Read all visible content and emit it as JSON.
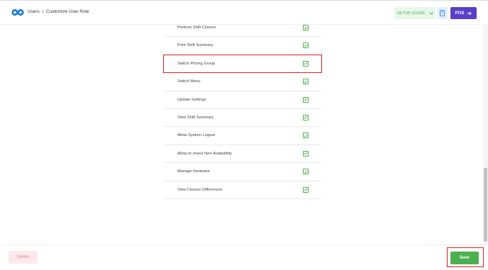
{
  "header": {
    "breadcrumb_parent": "Users",
    "breadcrumb_separator": "/",
    "breadcrumb_current": "Customize User Role",
    "setup_guide_label": "SETUP GUIDE",
    "pos_label": "POS"
  },
  "permissions": [
    {
      "label": "Perform Shift Closure",
      "checked": true
    },
    {
      "label": "Print Shift Summary",
      "checked": true
    },
    {
      "label": "Switch Pricing Group",
      "checked": true
    },
    {
      "label": "Switch Menu",
      "checked": true
    },
    {
      "label": "Update Settings",
      "checked": true
    },
    {
      "label": "View Shift Summary",
      "checked": true
    },
    {
      "label": "Allow System Logout",
      "checked": true
    },
    {
      "label": "Allow to check Item Availability",
      "checked": true
    },
    {
      "label": "Manage hardware",
      "checked": true
    },
    {
      "label": "View Closure Differences",
      "checked": true
    }
  ],
  "footer": {
    "delete_label": "Delete",
    "save_label": "Save"
  },
  "colors": {
    "accent_green": "#4caf50",
    "pos_purple": "#5b3fc7",
    "highlight_red": "#e01e1e"
  },
  "icons": {
    "logo": "infinity-logo-icon",
    "setup_chevron": "chevron-down-icon",
    "calculator": "calculator-icon",
    "pos_arrow": "arrow-right-icon",
    "check": "check-icon"
  }
}
